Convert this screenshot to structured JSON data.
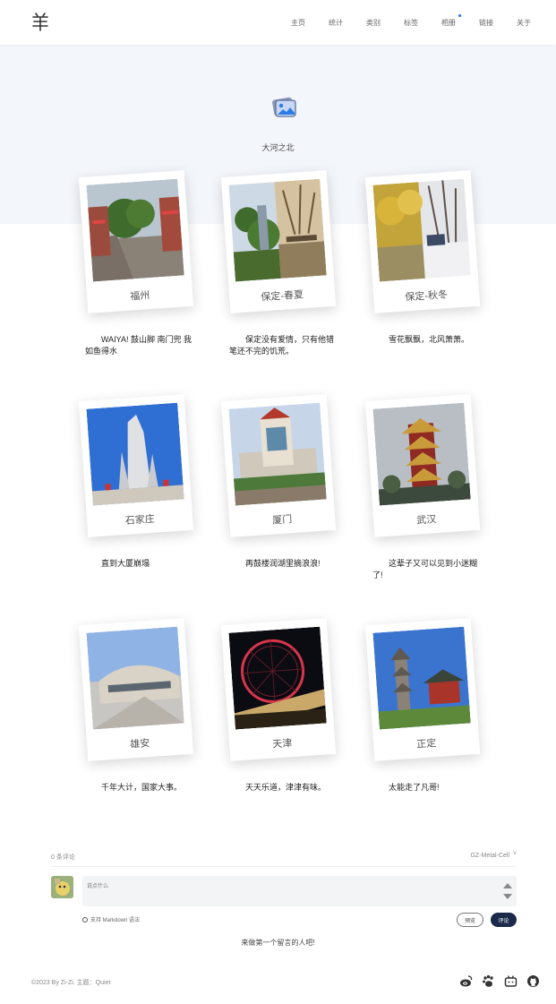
{
  "header": {
    "logo_text": "羊",
    "nav": [
      {
        "label": "主页"
      },
      {
        "label": "统计"
      },
      {
        "label": "类别"
      },
      {
        "label": "标签"
      },
      {
        "label": "相册"
      },
      {
        "label": "链接"
      },
      {
        "label": "关于"
      }
    ]
  },
  "hero": {
    "title": "大河之北",
    "icon": "photo-album-icon"
  },
  "albums": [
    {
      "label": "福州",
      "caption": "WAIYA! 鼓山脚 南门兜 我如鱼得水"
    },
    {
      "label": "保定-春夏",
      "caption": "保定没有爱情，只有他错笔还不完的饥荒。"
    },
    {
      "label": "保定-秋冬",
      "caption": "雪花飘飘，北风萧萧。"
    },
    {
      "label": "石家庄",
      "caption": "直到大厦崩塌"
    },
    {
      "label": "厦门",
      "caption": "再鼓楼润湖里摘浪浪!"
    },
    {
      "label": "武汉",
      "caption": "这辈子又可以见到小迷糊了!"
    },
    {
      "label": "雄安",
      "caption": "千年大计，国家大事。"
    },
    {
      "label": "天津",
      "caption": "天天乐道，津津有味。"
    },
    {
      "label": "正定",
      "caption": "太能走了凡哥!"
    }
  ],
  "comments": {
    "count_label": "0 条评论",
    "user_label": "GZ-Metal-Cell",
    "placeholder": "说点什么",
    "markdown_tip": "支持 Markdown 语法",
    "preview_label": "预览",
    "submit_label": "评论",
    "empty_text": "来做第一个留言的人吧!"
  },
  "footer": {
    "copyright": "©2023 By Zi-Zi. 主题：Quiet",
    "social_icons": [
      "weibo-icon",
      "paw-icon",
      "bilibili-icon",
      "github-icon"
    ]
  },
  "colors": {
    "hero_bg": "#f3f6fb",
    "accent": "#1e6fe8",
    "submit_bg": "#1b2a4a"
  }
}
